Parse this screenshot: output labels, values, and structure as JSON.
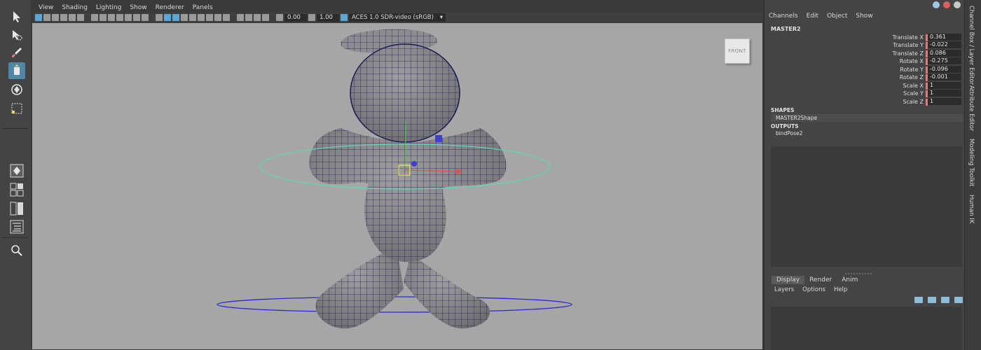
{
  "menubar": [
    "View",
    "Shading",
    "Lighting",
    "Show",
    "Renderer",
    "Panels"
  ],
  "iconbar": {
    "exposure_value": "0.00",
    "gamma_value": "1.00",
    "color_space": "ACES 1.0 SDR-video (sRGB)"
  },
  "viewcube_label": "FRONT",
  "channel_box": {
    "menu": [
      "Channels",
      "Edit",
      "Object",
      "Show"
    ],
    "object_name": "MASTER2",
    "attributes": [
      {
        "label": "Translate X",
        "value": "0.361"
      },
      {
        "label": "Translate Y",
        "value": "-0.022"
      },
      {
        "label": "Translate Z",
        "value": "0.086"
      },
      {
        "label": "Rotate X",
        "value": "-0.275"
      },
      {
        "label": "Rotate Y",
        "value": "-0.096"
      },
      {
        "label": "Rotate Z",
        "value": "-0.001"
      },
      {
        "label": "Scale X",
        "value": "1"
      },
      {
        "label": "Scale Y",
        "value": "1"
      },
      {
        "label": "Scale Z",
        "value": "1"
      }
    ],
    "shapes_header": "SHAPES",
    "shape_name": "MASTER2Shape",
    "outputs_header": "OUTPUTS",
    "output_name": "bindPose2"
  },
  "layer_editor": {
    "tabs": [
      "Display",
      "Render",
      "Anim"
    ],
    "active_tab": "Display",
    "menu": [
      "Layers",
      "Options",
      "Help"
    ]
  },
  "side_tabs": [
    "Channel Box / Layer Editor",
    "Attribute Editor",
    "Modeling Toolkit",
    "Human IK"
  ],
  "colors": {
    "accent": "#5285a6",
    "keyed_attr": "#e07b7b",
    "viewport_bg": "#a6a6a6",
    "wireframe": "#1e1e6e",
    "manipulator_ring": "#5fd6b8"
  }
}
